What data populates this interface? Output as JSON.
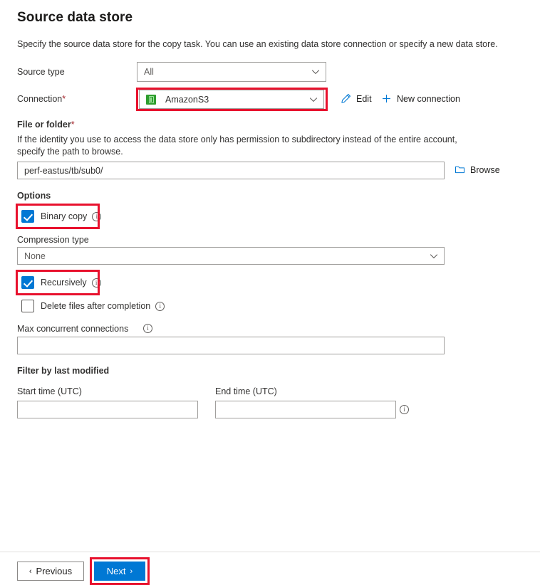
{
  "header": {
    "title": "Source data store",
    "description": "Specify the source data store for the copy task. You can use an existing data store connection or specify a new data store."
  },
  "form": {
    "source_type": {
      "label": "Source type",
      "value": "All"
    },
    "connection": {
      "label": "Connection",
      "required_marker": "*",
      "value": "AmazonS3",
      "icon": "amazon-s3-icon",
      "edit_label": "Edit",
      "edit_icon": "pencil-icon",
      "new_connection_label": "New connection",
      "new_connection_icon": "plus-icon"
    },
    "file_or_folder": {
      "label": "File or folder",
      "required_marker": "*",
      "helper": "If the identity you use to access the data store only has permission to subdirectory instead of the entire account, specify the path to browse.",
      "value": "perf-eastus/tb/sub0/",
      "placeholder": "",
      "browse_label": "Browse",
      "browse_icon": "folder-icon"
    },
    "options": {
      "label": "Options",
      "binary_copy": {
        "label": "Binary copy",
        "checked": true,
        "info_icon": "info-icon"
      },
      "compression_type": {
        "label": "Compression type",
        "value": "None"
      },
      "recursively": {
        "label": "Recursively",
        "checked": true,
        "info_icon": "info-icon"
      },
      "delete_files": {
        "label": "Delete files after completion",
        "checked": false,
        "info_icon": "info-icon"
      },
      "max_concurrent_connections": {
        "label": "Max concurrent connections",
        "value": "",
        "info_icon": "info-icon"
      }
    },
    "filter": {
      "label": "Filter by last modified",
      "start_time": {
        "label": "Start time (UTC)",
        "value": ""
      },
      "end_time": {
        "label": "End time (UTC)",
        "value": "",
        "info_icon": "info-icon"
      }
    }
  },
  "footer": {
    "previous_label": "Previous",
    "previous_arrow": "‹",
    "next_label": "Next",
    "next_arrow": "›"
  },
  "annotations": {
    "accent_color": "#0078d4",
    "highlight_color": "#e8112d"
  }
}
